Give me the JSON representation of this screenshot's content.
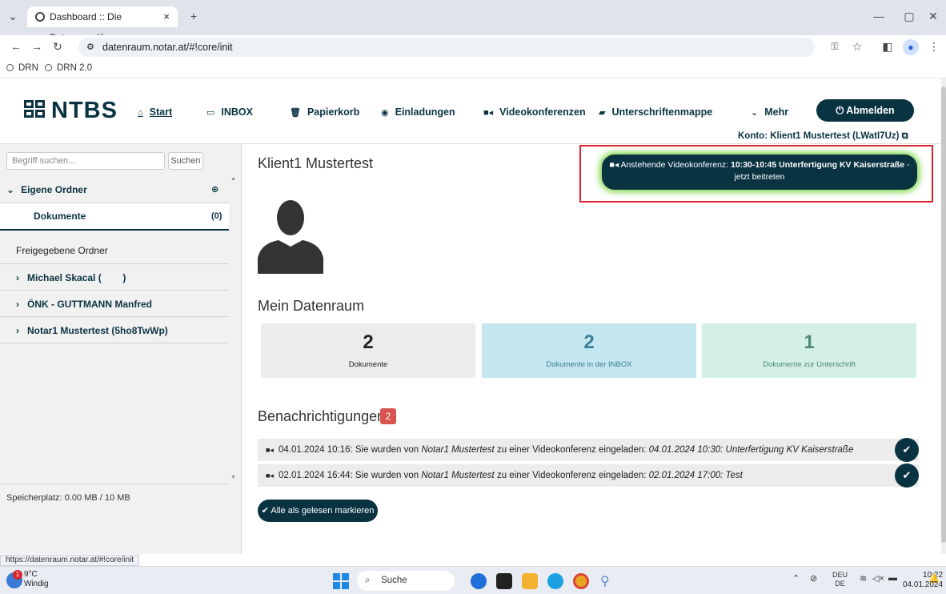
{
  "browser": {
    "tab_title": "Dashboard :: Die Datenraumlös",
    "tab_close": "×",
    "new_tab": "+",
    "url": "datenraum.notar.at/#!core/init",
    "bookmarks": [
      "DRN",
      "DRN 2.0"
    ],
    "window_controls": [
      "—",
      "▢",
      "✕"
    ]
  },
  "app": {
    "logo": "NTBS",
    "nav": [
      {
        "label": "Start",
        "icon": "home-icon"
      },
      {
        "label": "INBOX",
        "icon": "inbox-icon"
      },
      {
        "label": "Papierkorb",
        "icon": "trash-icon"
      },
      {
        "label": "Einladungen",
        "icon": "globe-icon"
      },
      {
        "label": "Videokonferenzen",
        "icon": "video-icon"
      },
      {
        "label": "Unterschriftenmappe",
        "icon": "folder-icon"
      },
      {
        "label": "Mehr",
        "icon": "chevron-down-icon"
      }
    ],
    "logout_label": "Abmelden",
    "konto": "Konto: Klient1 Mustertest (LWatI7Uz)"
  },
  "sidebar": {
    "search_placeholder": "Begriff suchen...",
    "search_button": "Suchen",
    "own_folders": "Eigene Ordner",
    "documents_label": "Dokumente",
    "documents_count": "(0)",
    "shared_folders": "Freigegebene Ordner",
    "shared": [
      "Michael Skacal (        )",
      "ÖNK - GUTTMANN Manfred",
      "Notar1 Mustertest (5ho8TwWp)"
    ],
    "storage": "Speicherplatz: 0.00 MB / 10 MB",
    "status_url": "https://datenraum.notar.at/#!core/init"
  },
  "main": {
    "user_name": "Klient1 Mustertest",
    "videoconf": {
      "prefix": "Anstehende Videokonferenz: ",
      "time_title": "10:30-10:45 Unterfertigung KV Kaiserstraße",
      "suffix": " - jetzt beitreten"
    },
    "datenraum_title": "Mein Datenraum",
    "stats": [
      {
        "value": "2",
        "label": "Dokumente",
        "bg": "#ececec",
        "color": "#222"
      },
      {
        "value": "2",
        "label": "Dokumente in der INBOX",
        "bg": "#c3e6ef",
        "color": "#3e7f93"
      },
      {
        "value": "1",
        "label": "Dokumente zur Unterschrift",
        "bg": "#d4efe4",
        "color": "#4c8a76"
      }
    ],
    "notifications_title": "Benachrichtigungen",
    "notifications_count": "2",
    "notifications": [
      {
        "prefix": "04.01.2024 10:16: Sie wurden von ",
        "who": "Notar1 Mustertest",
        "middle": " zu einer Videokonferenz eingeladen: ",
        "detail": "04.01.2024 10:30: Unterfertigung KV Kaiserstraße"
      },
      {
        "prefix": "02.01.2024 16:44: Sie wurden von ",
        "who": "Notar1 Mustertest",
        "middle": " zu einer Videokonferenz eingeladen: ",
        "detail": "02.01.2024 17:00: Test"
      }
    ],
    "mark_all": "Alle als gelesen markieren"
  },
  "taskbar": {
    "temp": "9°C",
    "weather": "Windig",
    "weather_badge": "1",
    "search": "Suche",
    "lang1": "DEU",
    "lang2": "DE",
    "time": "10:22",
    "date": "04.01.2024"
  }
}
